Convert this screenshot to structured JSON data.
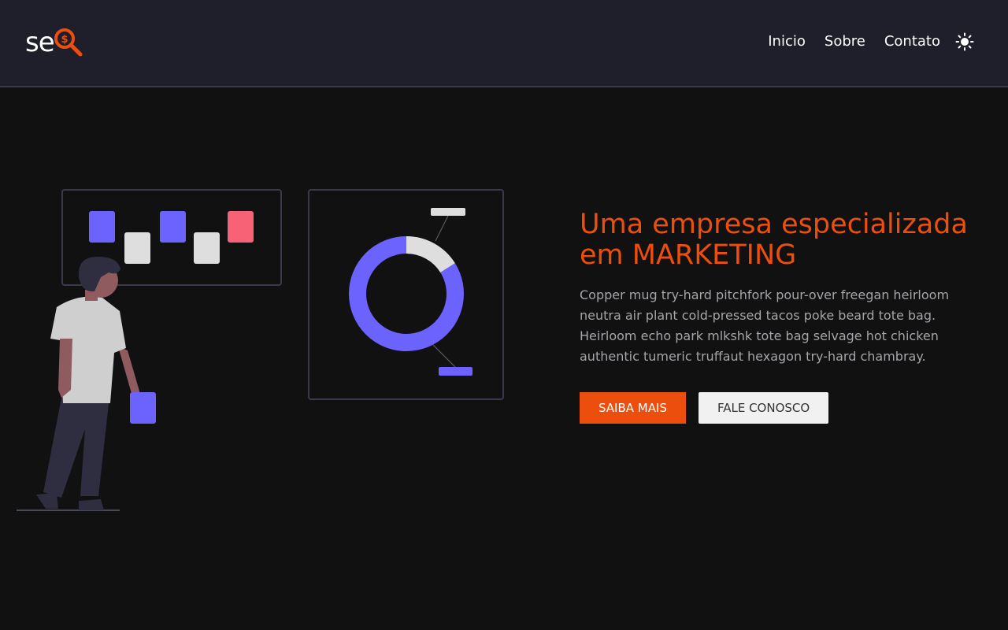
{
  "brand": {
    "logo_text": "se",
    "logo_icon": "magnifier-dollar-icon",
    "accent_color": "#ec4e0d"
  },
  "nav": {
    "items": [
      {
        "label": "Inicio"
      },
      {
        "label": "Sobre"
      },
      {
        "label": "Contato"
      }
    ],
    "theme_toggle_icon": "sun-icon"
  },
  "hero": {
    "title": "Uma empresa especializada em MARKETING",
    "description": "Copper mug try-hard pitchfork pour-over freegan heirloom neutra air plant cold-pressed tacos poke beard tote bag. Heirloom echo park mlkshk tote bag selvage hot chicken authentic tumeric truffaut hexagon try-hard chambray.",
    "primary_button": "SAIBA MAIS",
    "secondary_button": "FALE CONOSCO"
  }
}
